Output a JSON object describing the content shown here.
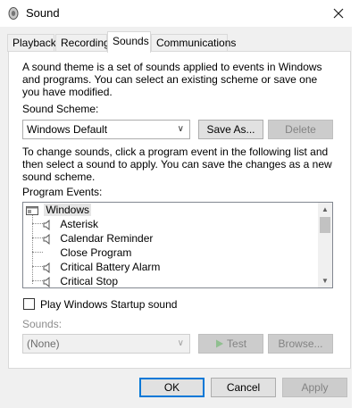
{
  "title": "Sound",
  "tabs": [
    {
      "label": "Playback",
      "active": false
    },
    {
      "label": "Recording",
      "active": false
    },
    {
      "label": "Sounds",
      "active": true
    },
    {
      "label": "Communications",
      "active": false
    }
  ],
  "intro_text": "A sound theme is a set of sounds applied to events in Windows and programs.  You can select an existing scheme or save one you have modified.",
  "scheme_label": "Sound Scheme:",
  "scheme_value": "Windows Default",
  "save_as_label": "Save As...",
  "delete_label": "Delete",
  "instructions_text": "To change sounds, click a program event in the following list and then select a sound to apply.  You can save the changes as a new sound scheme.",
  "events_label": "Program Events:",
  "events": {
    "root": "Windows",
    "items": [
      {
        "label": "Asterisk",
        "has_sound": true
      },
      {
        "label": "Calendar Reminder",
        "has_sound": true
      },
      {
        "label": "Close Program",
        "has_sound": false
      },
      {
        "label": "Critical Battery Alarm",
        "has_sound": true
      },
      {
        "label": "Critical Stop",
        "has_sound": true
      }
    ]
  },
  "startup_label": "Play Windows Startup sound",
  "startup_checked": false,
  "sounds_label": "Sounds:",
  "sounds_value": "(None)",
  "test_label": "Test",
  "browse_label": "Browse...",
  "ok_label": "OK",
  "cancel_label": "Cancel",
  "apply_label": "Apply"
}
